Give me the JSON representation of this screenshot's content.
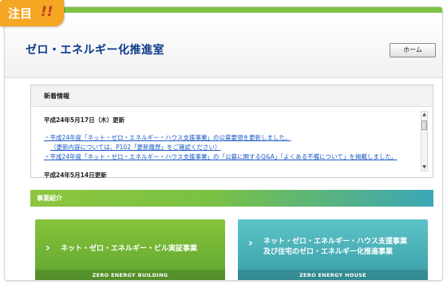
{
  "badge": {
    "label": "注目",
    "marks": "!!"
  },
  "header": {
    "title": "ゼロ・エネルギー化推進室",
    "home_label": "ホーム"
  },
  "news": {
    "title": "新着情報",
    "entries": [
      {
        "date": "平成24年5月17日（木）更新",
        "links": [
          "・平成24年度「ネット・ゼロ・エネルギー・ハウス支援事業」の公募要領を更新しました。",
          "（更新内容については、P102「更新履歴」をご確認ください）",
          "・平成24年度「ネット・ゼロ・エネルギー・ハウス支援事業」の「公募に関するQ&A」「よくある不備について」を掲載しました。"
        ]
      },
      {
        "date": "平成24年5月14日更新",
        "links": []
      }
    ]
  },
  "section": {
    "title": "事業紹介"
  },
  "cards": [
    {
      "title": "ネット・ゼロ・エネルギー・ビル実証事業",
      "footer": "ZERO ENERGY BUILDING",
      "chevron": "›"
    },
    {
      "title_line1": "ネット・ゼロ・エネルギー・ハウス支援事業",
      "title_line2": "及び住宅のゼロ・エネルギー化推進事業",
      "footer": "ZERO ENERGY HOUSE",
      "chevron": "›"
    }
  ],
  "colors": {
    "accent_green": "#7dc242",
    "title_blue": "#0b3a8c",
    "link_blue": "#1a58c8",
    "badge_orange": "#f5a623",
    "teal": "#3aa7b8"
  },
  "scrollbar": {
    "up_icon": "▲",
    "down_icon": "▼"
  }
}
